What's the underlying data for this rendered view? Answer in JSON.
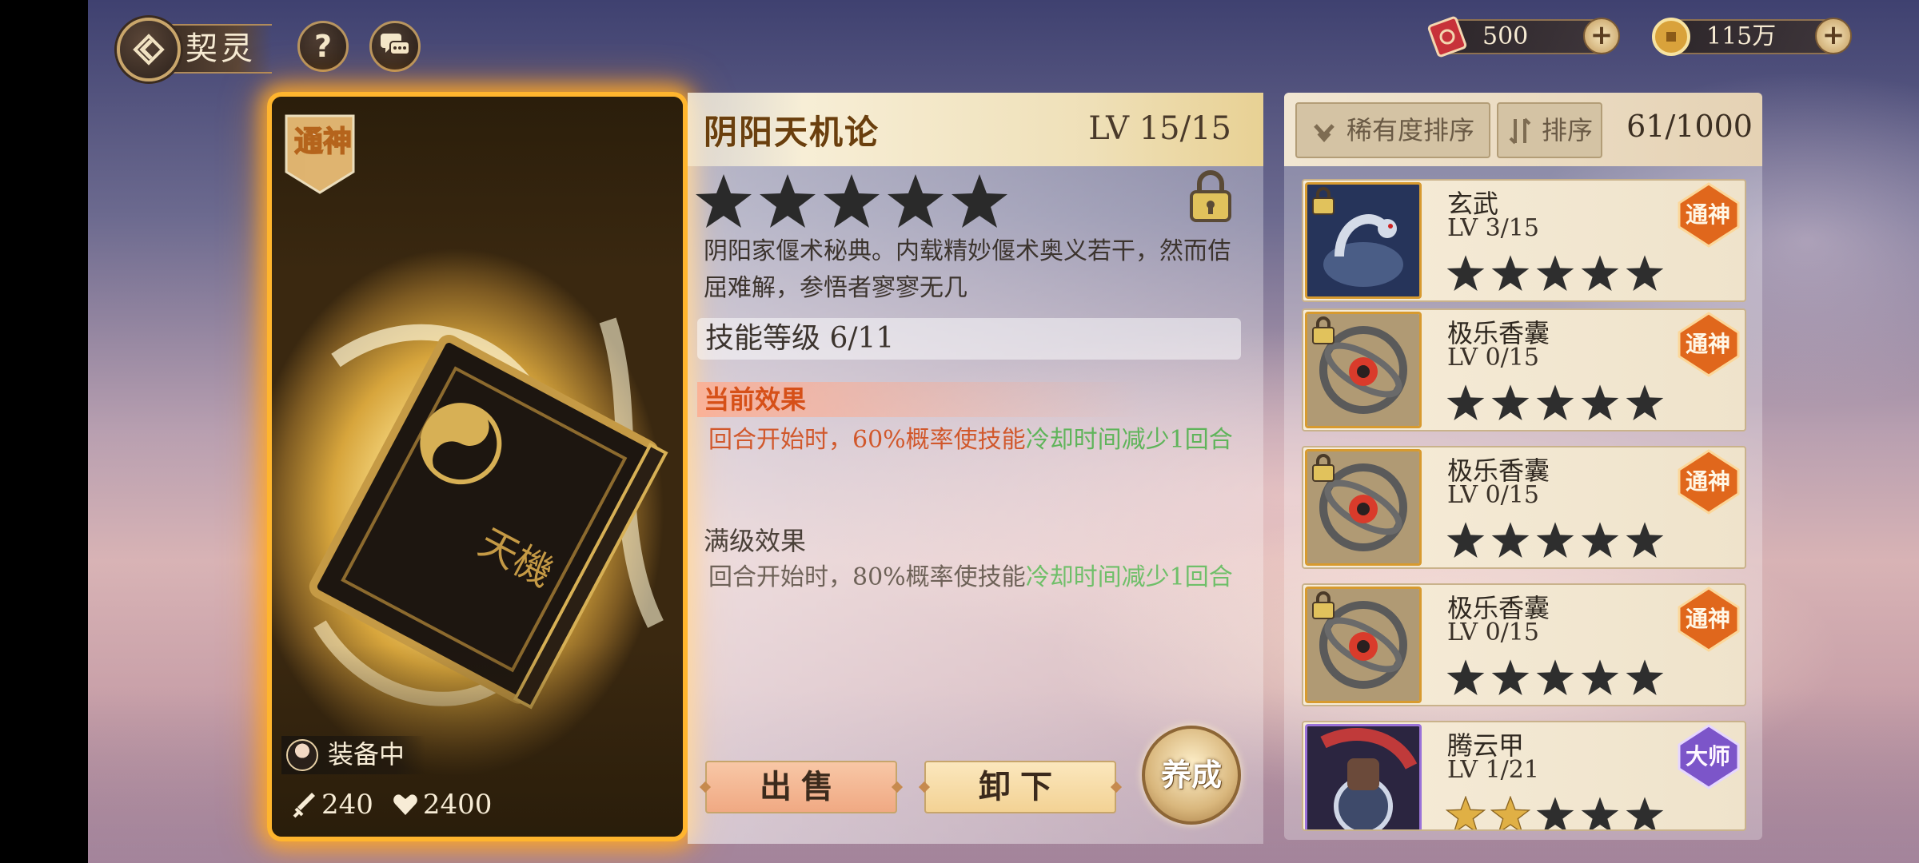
{
  "header": {
    "title": "契灵",
    "back_icon": "diamond-arrow-back-icon",
    "help_label": "?",
    "chat_icon": "chat-bubbles-icon"
  },
  "currencies": [
    {
      "name": "ticket",
      "icon": "red-ticket-icon",
      "amount": "500"
    },
    {
      "name": "coin",
      "icon": "gold-coin-icon",
      "amount": "115万"
    }
  ],
  "card": {
    "rank_badge": "通神",
    "equipped_label": "装备中",
    "attack": "240",
    "hp": "2400",
    "attack_icon": "sword-icon",
    "hp_icon": "heart-icon"
  },
  "detail": {
    "name": "阴阳天机论",
    "level": "LV 15/15",
    "stars": 5,
    "star_color": "#2a2a2a",
    "locked": true,
    "description": "阴阳家偃术秘典。内载精妙偃术奥义若干，然而佶屈难解，参悟者寥寥无几",
    "skill_level": "技能等级 6/11",
    "current_effect_title": "当前效果",
    "current_effect": {
      "part1": "回合开始时，60%概率使技能",
      "part2": "冷却时间减少1回合"
    },
    "max_effect_title": "满级效果",
    "max_effect": {
      "part1": "回合开始时，80%概率使技能",
      "part2": "冷却时间减少1回合"
    },
    "sell_label": "出售",
    "unload_label": "卸下",
    "develop_label": "养成"
  },
  "list": {
    "sort_rarity_label": "稀有度排序",
    "sort_label": "排序",
    "count": "61/1000",
    "items": [
      {
        "name": "玄武",
        "level": "LV 3/15",
        "rank": "通神",
        "gold_stars": 0,
        "locked": true,
        "art": "snake-turtle"
      },
      {
        "name": "极乐香囊",
        "level": "LV 0/15",
        "rank": "通神",
        "gold_stars": 0,
        "locked": true,
        "art": "sachet"
      },
      {
        "name": "极乐香囊",
        "level": "LV 0/15",
        "rank": "通神",
        "gold_stars": 0,
        "locked": true,
        "art": "sachet"
      },
      {
        "name": "极乐香囊",
        "level": "LV 0/15",
        "rank": "通神",
        "gold_stars": 0,
        "locked": true,
        "art": "sachet"
      },
      {
        "name": "腾云甲",
        "level": "LV 1/21",
        "rank": "大师",
        "gold_stars": 2,
        "locked": false,
        "art": "armor"
      }
    ]
  },
  "colors": {
    "rank_tongshen": "#e0671c",
    "rank_dashi": "#7c55c9",
    "card_glow": "#ffb52e",
    "green_text": "#5fb45a",
    "orange_text": "#d1582c"
  }
}
